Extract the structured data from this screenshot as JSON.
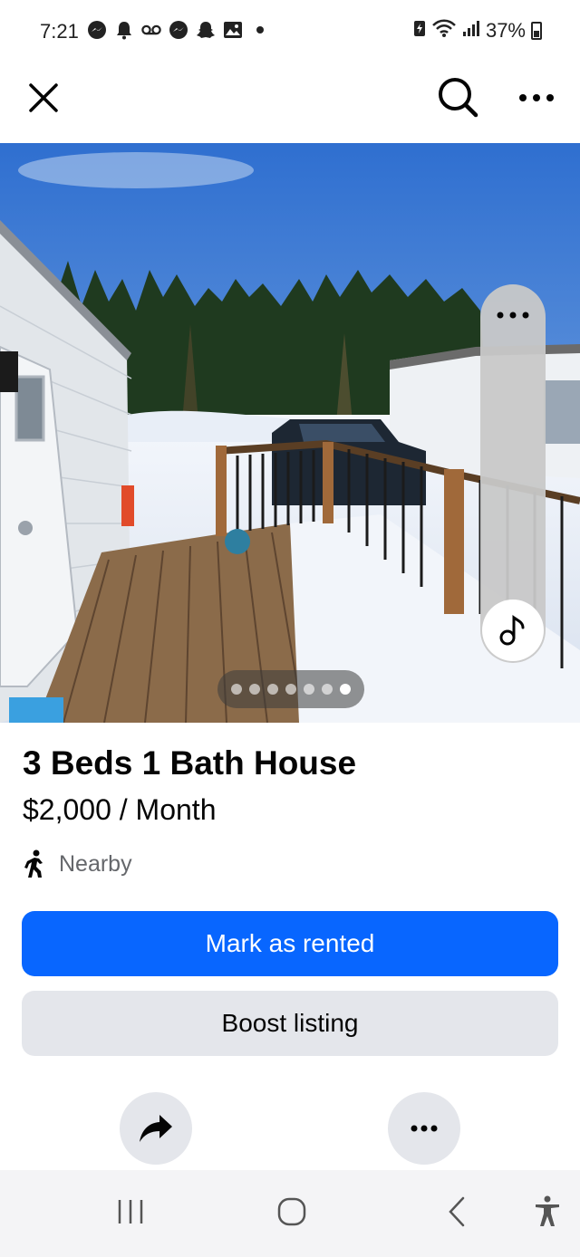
{
  "status_bar": {
    "time": "7:21",
    "battery": "37%",
    "left_icons": [
      "messenger-icon",
      "notification-bell-icon",
      "voicemail-icon",
      "messenger-icon",
      "snapchat-icon",
      "gallery-icon",
      "dot-icon"
    ],
    "right_icons": [
      "battery-saver-icon",
      "wifi-icon",
      "signal-icon",
      "battery-icon"
    ]
  },
  "photo": {
    "page_count": 7,
    "active_index": 6
  },
  "listing": {
    "title": "3 Beds 1 Bath House",
    "price": "$2,000 / Month",
    "location": "Nearby"
  },
  "actions": {
    "primary_label": "Mark as rented",
    "secondary_label": "Boost listing"
  },
  "colors": {
    "primary": "#0866ff",
    "secondary_bg": "#e4e6eb",
    "muted_text": "#65676b"
  }
}
